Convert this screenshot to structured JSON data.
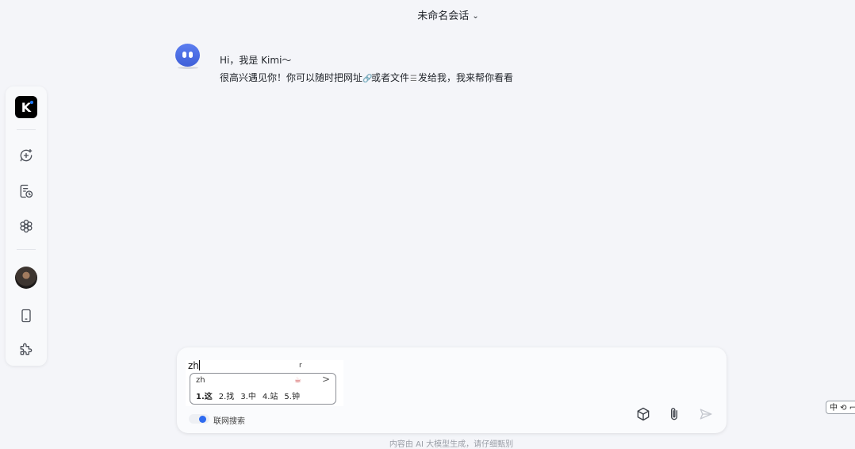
{
  "header": {
    "title": "未命名会话",
    "chevron_icon": "chevron-down-icon"
  },
  "sidebar": {
    "logo_text": "K",
    "items": [
      {
        "name": "new-chat",
        "icon": "chat-plus-icon"
      },
      {
        "name": "history",
        "icon": "history-icon"
      },
      {
        "name": "explore",
        "icon": "flower-icon"
      },
      {
        "name": "user-avatar",
        "icon": "avatar"
      },
      {
        "name": "mobile-app",
        "icon": "phone-icon"
      },
      {
        "name": "plugins",
        "icon": "puzzle-icon"
      }
    ]
  },
  "message": {
    "greeting": "Hi，我是 Kimi～",
    "body_before_link": "很高兴遇见你！你可以随时把网址",
    "body_link_icon": "🔗",
    "body_mid": "或者文件",
    "body_file_icon": "☰",
    "body_after": "发给我，我来帮你看看"
  },
  "composer": {
    "input_value": "zh",
    "ime": {
      "marker": "r",
      "pinyin": "zh",
      "emoji": "☕",
      "next": ">",
      "candidates": [
        "1.这",
        "2.找",
        "3.中",
        "4.站",
        "5.钟"
      ]
    },
    "web_search_label": "联网搜索"
  },
  "footer_note": "内容由 AI 大模型生成，请仔细甄别",
  "system": {
    "ime_indicator": "中 ⟲ ⌐"
  },
  "colors": {
    "accent": "#2f6bf0",
    "bot": "#4a6ae6",
    "background": "#f4f5f9"
  }
}
